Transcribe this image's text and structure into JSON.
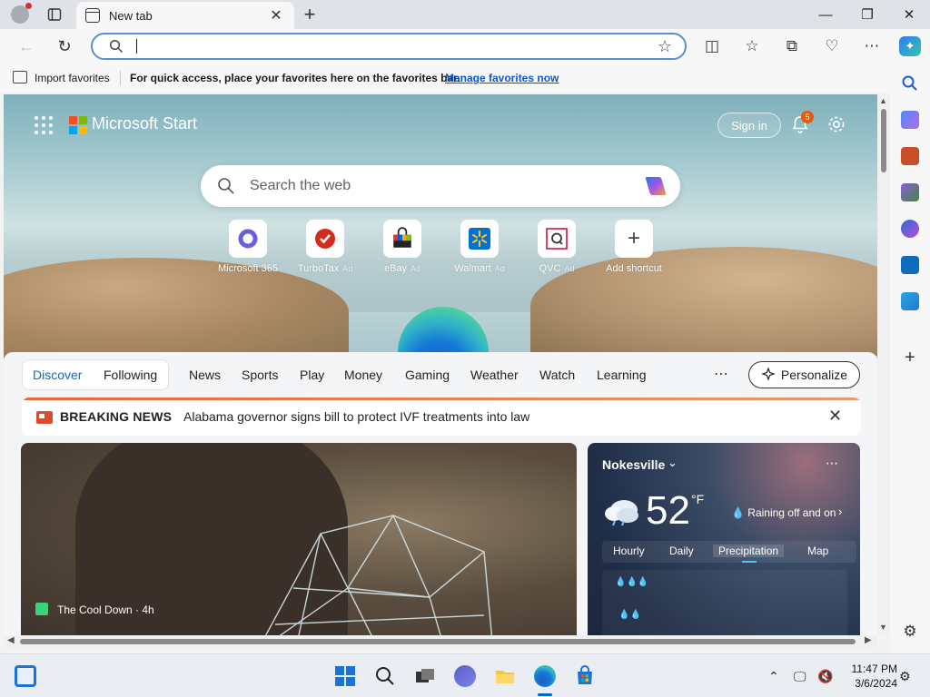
{
  "browser": {
    "tab_title": "New tab",
    "address_value": "",
    "favorites_bar": {
      "import_label": "Import favorites",
      "hint": "For quick access, place your favorites here on the favorites bar.",
      "manage_link": "Manage favorites now"
    }
  },
  "page": {
    "brand": "Microsoft Start",
    "sign_in": "Sign in",
    "notification_count": "5",
    "search_placeholder": "Search the web",
    "shortcuts": [
      {
        "label": "Microsoft 365",
        "ad": "",
        "icon": "microsoft-365-icon"
      },
      {
        "label": "TurboTax",
        "ad": "Ad",
        "icon": "turbotax-icon"
      },
      {
        "label": "eBay",
        "ad": "Ad",
        "icon": "ebay-icon"
      },
      {
        "label": "Walmart",
        "ad": "Ad",
        "icon": "walmart-icon"
      },
      {
        "label": "QVC",
        "ad": "Ad",
        "icon": "qvc-icon"
      },
      {
        "label": "Add shortcut",
        "ad": "",
        "icon": "plus-icon"
      }
    ],
    "feed_tabs": [
      "Discover",
      "Following",
      "News",
      "Sports",
      "Play",
      "Money",
      "Gaming",
      "Weather",
      "Watch",
      "Learning"
    ],
    "active_feed_tab": "Discover",
    "personalize": "Personalize",
    "breaking": {
      "label": "BREAKING NEWS",
      "text": "Alabama governor signs bill to protect IVF treatments into law"
    },
    "hero_story": {
      "source": "The Cool Down · 4h"
    },
    "weather": {
      "location": "Nokesville",
      "temp": "52",
      "unit": "°F",
      "condition": "Raining off and on",
      "tabs": [
        "Hourly",
        "Daily",
        "Precipitation",
        "Map"
      ],
      "active_tab": "Precipitation"
    }
  },
  "taskbar": {
    "time": "11:47 PM",
    "date": "3/6/2024"
  },
  "colors": {
    "accent": "#0b6bcb",
    "omnibox_border": "#5a8fd6",
    "breaking_icon": "#e04a2a",
    "notification_badge": "#e8590c"
  }
}
